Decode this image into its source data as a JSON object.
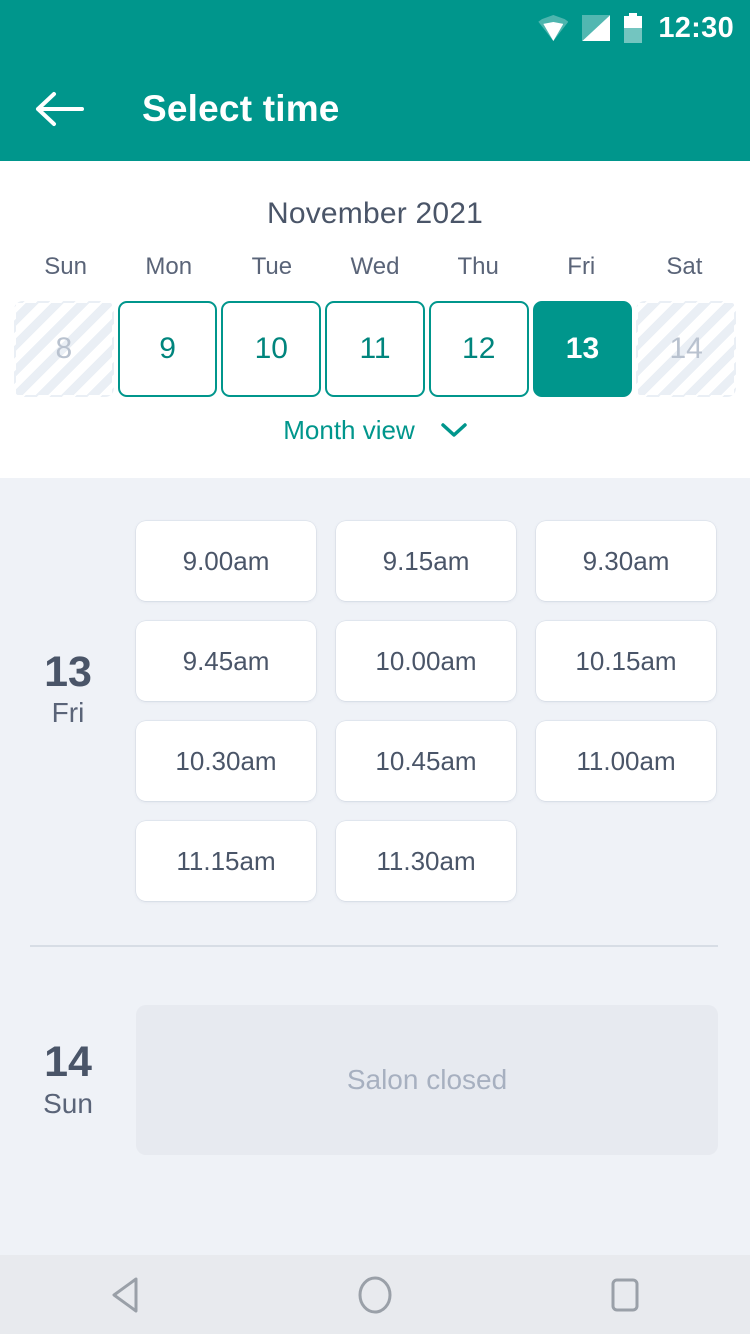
{
  "status_bar": {
    "clock": "12:30",
    "icons": [
      "wifi-icon",
      "signal-icon",
      "battery-icon"
    ]
  },
  "app_bar": {
    "back_icon": "back-arrow-icon",
    "title": "Select time"
  },
  "calendar": {
    "month_title": "November 2021",
    "weekday_names": [
      "Sun",
      "Mon",
      "Tue",
      "Wed",
      "Thu",
      "Fri",
      "Sat"
    ],
    "days": [
      {
        "num": "8",
        "state": "disabled"
      },
      {
        "num": "9",
        "state": "enabled"
      },
      {
        "num": "10",
        "state": "enabled"
      },
      {
        "num": "11",
        "state": "enabled"
      },
      {
        "num": "12",
        "state": "enabled"
      },
      {
        "num": "13",
        "state": "selected"
      },
      {
        "num": "14",
        "state": "disabled"
      }
    ],
    "month_view_label": "Month view",
    "month_view_chevron": "chevron-down-icon"
  },
  "schedule": [
    {
      "day_number": "13",
      "weekday": "Fri",
      "slots": [
        "9.00am",
        "9.15am",
        "9.30am",
        "9.45am",
        "10.00am",
        "10.15am",
        "10.30am",
        "10.45am",
        "11.00am",
        "11.15am",
        "11.30am"
      ]
    },
    {
      "day_number": "14",
      "weekday": "Sun",
      "closed_label": "Salon closed"
    }
  ],
  "nav_bar": {
    "buttons": [
      "back-triangle-icon",
      "home-circle-icon",
      "recents-square-icon"
    ]
  },
  "colors": {
    "primary": "#00968c",
    "page_bg": "#eff2f7",
    "card_bg": "#ffffff",
    "text_dark": "#4a5568",
    "text_muted": "#a7b0c0",
    "closed_bg": "#e7eaf0"
  }
}
